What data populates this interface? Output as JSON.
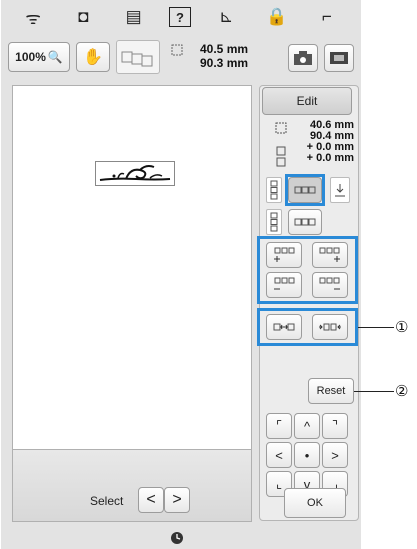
{
  "topbar": {
    "icons": [
      "wifi-icon",
      "camera-icon",
      "document-icon",
      "help-icon",
      "sewing-icon",
      "lock-icon",
      "presser-foot-icon"
    ],
    "glyphs": [
      "ᯤ",
      "◘",
      "▤",
      "?",
      "⊾",
      "🔒",
      "⌐"
    ]
  },
  "toolbar": {
    "zoom_label": "100%",
    "zoom_glyph": "🔍",
    "hand_glyph": "✋",
    "size_width": "40.5 mm",
    "size_height": "90.3 mm"
  },
  "canvas": {
    "select_label": "Select",
    "prev": "<",
    "next": ">"
  },
  "panel": {
    "edit_label": "Edit",
    "dim_width": "40.6 mm",
    "dim_height": "90.4 mm",
    "offset_x": "+ 0.0 mm",
    "offset_y": "+ 0.0 mm",
    "reset_label": "Reset",
    "ok_label": "OK",
    "arrows": [
      "⌜",
      "^",
      "⌝",
      "<",
      "•",
      ">",
      "⌞",
      "v",
      "⌟"
    ]
  },
  "callouts": {
    "c1": "①",
    "c2": "②"
  },
  "accent": "#2a8ad7"
}
